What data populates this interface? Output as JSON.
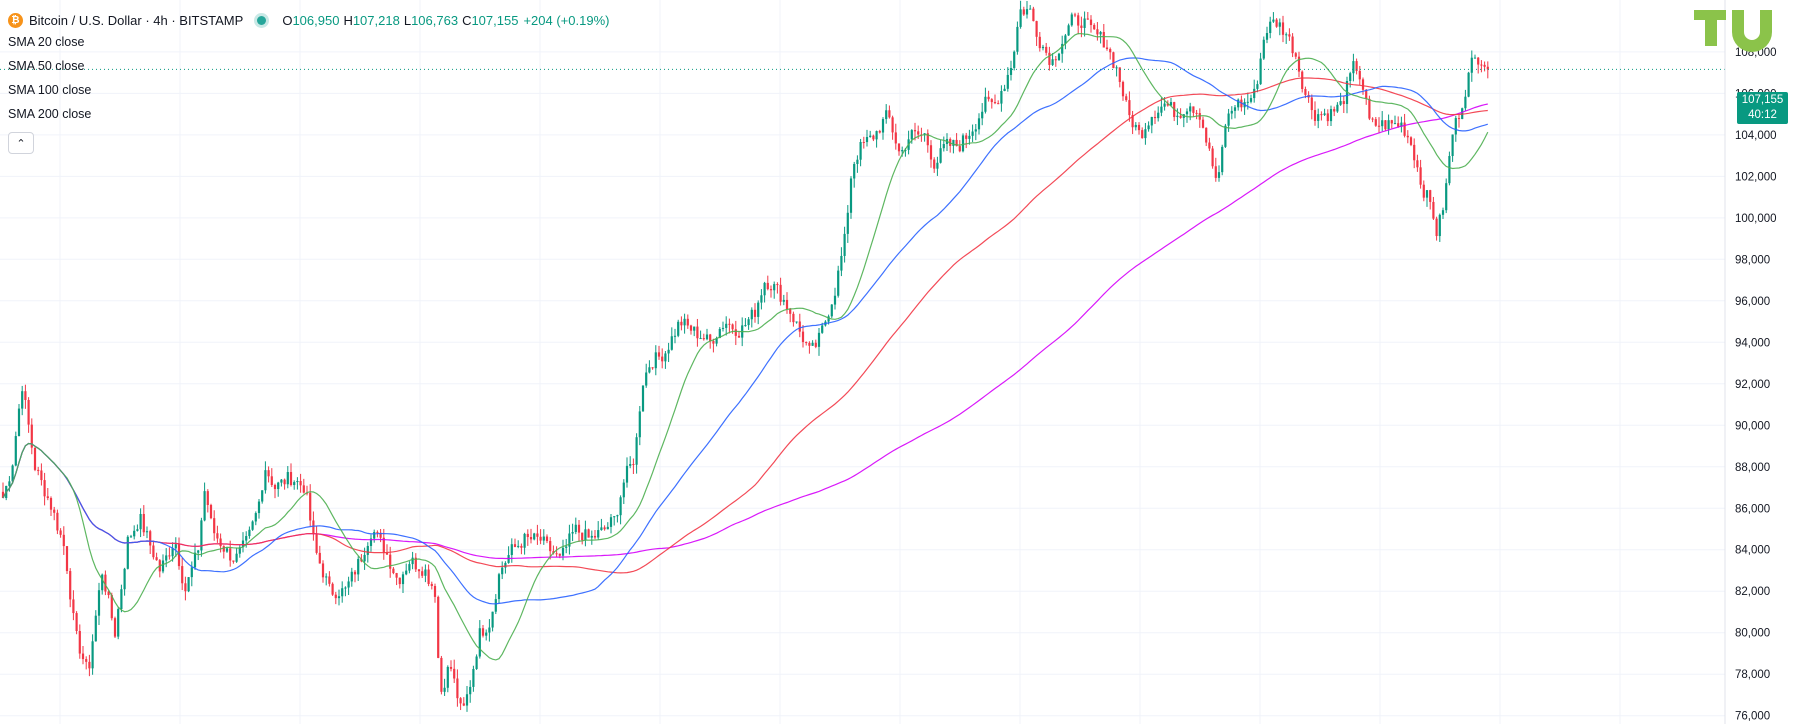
{
  "header": {
    "symbol": "Bitcoin / U.S. Dollar · 4h · BITSTAMP",
    "coin_glyph": "₿",
    "open_label": "O",
    "open": "106,950",
    "high_label": "H",
    "high": "107,218",
    "low_label": "L",
    "low": "106,763",
    "close_label": "C",
    "close": "107,155",
    "change": "+204 (+0.19%)"
  },
  "indicators": [
    "SMA 20 close",
    "SMA 50 close",
    "SMA 100 close",
    "SMA 200 close"
  ],
  "collapse_glyph": "⌃",
  "price_tag": {
    "price": "107,155",
    "countdown": "40:12"
  },
  "colors": {
    "up": "#089981",
    "down": "#f23645",
    "sma20": "#4caf50",
    "sma50": "#2962ff",
    "sma100": "#f23645",
    "sma200": "#d500f9",
    "grid": "#f0f3fa",
    "logo": "#8bc34a"
  },
  "chart_data": {
    "type": "candlestick",
    "yaxis": {
      "ticks": [
        76000,
        78000,
        80000,
        82000,
        84000,
        86000,
        88000,
        90000,
        92000,
        94000,
        96000,
        98000,
        100000,
        102000,
        104000,
        106000,
        108000
      ],
      "tick_labels": [
        "76,000",
        "78,000",
        "80,000",
        "82,000",
        "84,000",
        "86,000",
        "88,000",
        "90,000",
        "92,000",
        "94,000",
        "96,000",
        "98,000",
        "100,000",
        "102,000",
        "104,000",
        "106,000",
        "108,000"
      ],
      "range": [
        75600,
        110500
      ]
    },
    "close_path": [
      [
        0,
        86000
      ],
      [
        12,
        88000
      ],
      [
        22,
        92000
      ],
      [
        35,
        88000
      ],
      [
        52,
        86000
      ],
      [
        65,
        84000
      ],
      [
        75,
        80000
      ],
      [
        88,
        78000
      ],
      [
        102,
        83000
      ],
      [
        115,
        80000
      ],
      [
        128,
        84500
      ],
      [
        140,
        85500
      ],
      [
        160,
        83000
      ],
      [
        175,
        84500
      ],
      [
        185,
        82000
      ],
      [
        198,
        84000
      ],
      [
        205,
        87000
      ],
      [
        212,
        85000
      ],
      [
        225,
        84000
      ],
      [
        235,
        83500
      ],
      [
        248,
        84500
      ],
      [
        258,
        86000
      ],
      [
        265,
        88000
      ],
      [
        275,
        87000
      ],
      [
        290,
        87500
      ],
      [
        305,
        87000
      ],
      [
        315,
        84000
      ],
      [
        330,
        82000
      ],
      [
        345,
        82000
      ],
      [
        360,
        83500
      ],
      [
        372,
        85000
      ],
      [
        385,
        84000
      ],
      [
        398,
        82500
      ],
      [
        410,
        83500
      ],
      [
        425,
        83000
      ],
      [
        435,
        82000
      ],
      [
        440,
        77000
      ],
      [
        450,
        78500
      ],
      [
        462,
        76000
      ],
      [
        470,
        77500
      ],
      [
        480,
        80000
      ],
      [
        490,
        80500
      ],
      [
        500,
        83000
      ],
      [
        512,
        84000
      ],
      [
        525,
        84500
      ],
      [
        540,
        84500
      ],
      [
        550,
        84000
      ],
      [
        560,
        83500
      ],
      [
        575,
        85000
      ],
      [
        590,
        84500
      ],
      [
        605,
        85000
      ],
      [
        615,
        85500
      ],
      [
        625,
        87500
      ],
      [
        635,
        88500
      ],
      [
        642,
        92000
      ],
      [
        650,
        93000
      ],
      [
        665,
        93500
      ],
      [
        680,
        95000
      ],
      [
        695,
        94500
      ],
      [
        710,
        94000
      ],
      [
        725,
        95000
      ],
      [
        740,
        94500
      ],
      [
        755,
        95500
      ],
      [
        765,
        97000
      ],
      [
        778,
        96500
      ],
      [
        790,
        95500
      ],
      [
        800,
        94500
      ],
      [
        810,
        93500
      ],
      [
        818,
        94000
      ],
      [
        825,
        95000
      ],
      [
        835,
        96500
      ],
      [
        845,
        99000
      ],
      [
        852,
        102500
      ],
      [
        862,
        103500
      ],
      [
        875,
        104000
      ],
      [
        888,
        105000
      ],
      [
        900,
        103000
      ],
      [
        910,
        104000
      ],
      [
        925,
        104000
      ],
      [
        935,
        102500
      ],
      [
        945,
        103500
      ],
      [
        960,
        103500
      ],
      [
        975,
        104500
      ],
      [
        985,
        105500
      ],
      [
        995,
        105500
      ],
      [
        1005,
        106500
      ],
      [
        1012,
        107500
      ],
      [
        1020,
        110000
      ],
      [
        1030,
        110000
      ],
      [
        1040,
        108500
      ],
      [
        1052,
        107500
      ],
      [
        1062,
        108500
      ],
      [
        1072,
        109500
      ],
      [
        1082,
        109500
      ],
      [
        1092,
        109000
      ],
      [
        1105,
        108500
      ],
      [
        1118,
        107000
      ],
      [
        1128,
        105000
      ],
      [
        1140,
        104000
      ],
      [
        1152,
        105000
      ],
      [
        1165,
        105500
      ],
      [
        1178,
        105000
      ],
      [
        1190,
        105500
      ],
      [
        1200,
        105000
      ],
      [
        1210,
        103000
      ],
      [
        1218,
        101500
      ],
      [
        1225,
        104500
      ],
      [
        1235,
        105500
      ],
      [
        1245,
        105500
      ],
      [
        1255,
        106000
      ],
      [
        1265,
        109000
      ],
      [
        1275,
        109500
      ],
      [
        1285,
        109000
      ],
      [
        1295,
        108000
      ],
      [
        1305,
        106000
      ],
      [
        1315,
        105000
      ],
      [
        1330,
        105000
      ],
      [
        1342,
        105500
      ],
      [
        1355,
        107500
      ],
      [
        1362,
        106500
      ],
      [
        1370,
        104500
      ],
      [
        1380,
        104500
      ],
      [
        1392,
        104500
      ],
      [
        1402,
        104500
      ],
      [
        1412,
        103500
      ],
      [
        1422,
        101500
      ],
      [
        1432,
        100500
      ],
      [
        1437,
        99200
      ],
      [
        1445,
        101000
      ],
      [
        1452,
        104000
      ],
      [
        1462,
        105500
      ],
      [
        1472,
        107500
      ],
      [
        1480,
        107800
      ],
      [
        1490,
        107155
      ]
    ],
    "price_line": 107155
  }
}
